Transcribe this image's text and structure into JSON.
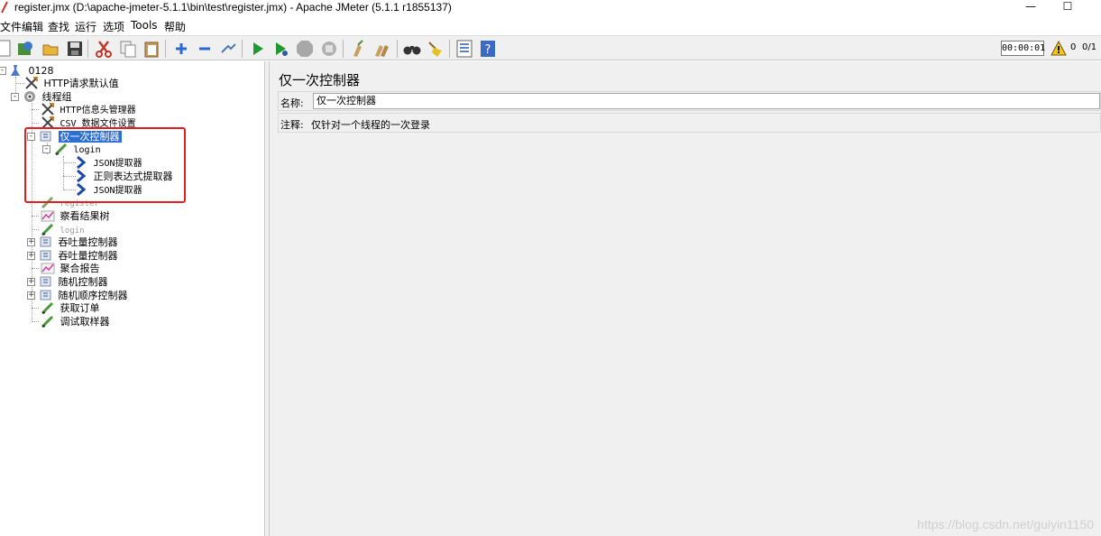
{
  "window": {
    "title": "register.jmx (D:\\apache-jmeter-5.1.1\\bin\\test\\register.jmx) - Apache JMeter (5.1.1 r1855137)",
    "minimize": "—",
    "maximize": "☐"
  },
  "menu": [
    "文件",
    "编辑",
    "查找",
    "运行",
    "选项",
    "Tools",
    "帮助"
  ],
  "toolbar": {
    "timer": "00:00:01",
    "warnings": "0",
    "threads": "0/1"
  },
  "tree": {
    "root": "0128",
    "http_defaults": "HTTP请求默认值",
    "thread_group": "线程组",
    "header_manager": "HTTP信息头管理器",
    "csv_dataset": "CSV 数据文件设置",
    "once_controller": "仅一次控制器",
    "login_sampler": "login",
    "json_extractor_1": "JSON提取器",
    "regex_extractor": "正则表达式提取器",
    "json_extractor_2": "JSON提取器",
    "register": "register",
    "view_results_tree": "察看结果树",
    "login_disabled": "login",
    "throughput_1": "吞吐量控制器",
    "throughput_2": "吞吐量控制器",
    "aggregate_report": "聚合报告",
    "random_controller": "随机控制器",
    "random_order_controller": "随机顺序控制器",
    "get_order": "获取订单",
    "debug_sampler": "调试取样器"
  },
  "editor": {
    "title": "仅一次控制器",
    "name_label": "名称:",
    "name_value": "仅一次控制器",
    "comment_label": "注释:",
    "comment_value": "仅针对一个线程的一次登录"
  },
  "watermark": "https://blog.csdn.net/guiyin1150",
  "colors": {
    "selection": "#2e6fd3",
    "highlight_box": "#e02020",
    "panel_bg": "#f0f0f0"
  }
}
